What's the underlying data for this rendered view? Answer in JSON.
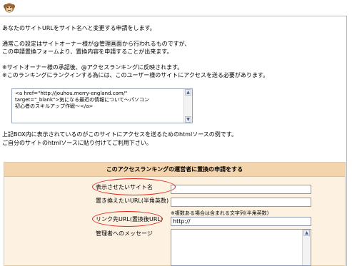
{
  "intro": {
    "line1": "あなたのサイトURLをサイト名へと変更する申請をします。",
    "line2": "通常この設定はサイトオーナー様が@管理画面から行われるものですが、",
    "line3": "この申請置換フォームより、置換内容を申請することが出来ます。",
    "line4": "※サイトオーナー様の承認後、@アクセスランキングに反映されます。",
    "line5": "※このランキングにランクインする為には、このユーザー様のサイトにアクセスを送る必要があります。"
  },
  "code_box": {
    "text": "<a href=\"http://jouhou.merry-england.com/\"\ntarget=\"_blank\">気になる最近の情報について～パソコン\n初心者のスキルアップ作戦～</a>"
  },
  "after_box": {
    "line1": "上記BOX内に表示されているのがこのサイトにアクセスを送るためのhtmlソースの例です。",
    "line2": "ご自分のサイトのhtmlソースに貼り付けてご利用下さい。"
  },
  "form": {
    "title": "このアクセスランキングの運営者に置換の申請をする",
    "fields": {
      "display_site_name_label": "表示させたいサイト名",
      "replace_url_label": "置き換えたいURL(半角英数)",
      "link_url_label": "リンク先URL(置換後URL)",
      "link_url_value": "http://",
      "message_label": "管理者へのメッセージ",
      "note": "※複数ある場合は含まれる文字列(半角英数)"
    }
  },
  "icons": {
    "mascot": "monkey-icon",
    "scroll_up": "scroll-up-arrow-icon",
    "scroll_down": "scroll-down-arrow-icon"
  },
  "colors": {
    "panel_bg": "#fdf2e2",
    "panel_header": "#f4d4ac",
    "highlight_oval": "#e0241b"
  }
}
